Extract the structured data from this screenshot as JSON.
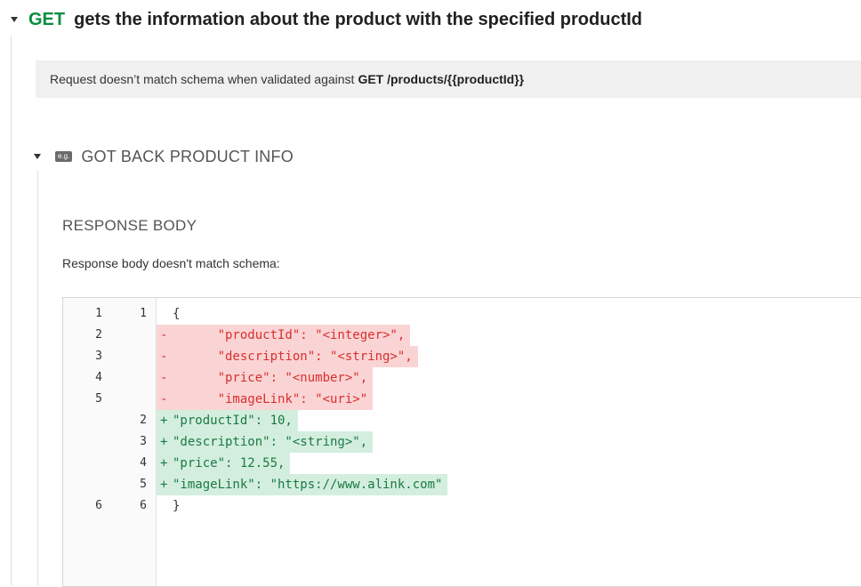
{
  "request": {
    "method": "GET",
    "title": "gets the information about the product with the specified productId",
    "validation_message": "Request doesn’t match schema when validated against",
    "validation_endpoint": "GET /products/{{productId}}"
  },
  "example": {
    "badge": "e.g.",
    "name": "GOT BACK PRODUCT INFO",
    "response_body_heading": "RESPONSE BODY",
    "response_body_message": "Response body doesn't match schema:"
  },
  "diff": [
    {
      "old": "1",
      "new": "1",
      "type": "context",
      "sign": " ",
      "text": "{"
    },
    {
      "old": "2",
      "new": "",
      "type": "removed",
      "sign": "-",
      "text": "      \"productId\": \"<integer>\","
    },
    {
      "old": "3",
      "new": "",
      "type": "removed",
      "sign": "-",
      "text": "      \"description\": \"<string>\","
    },
    {
      "old": "4",
      "new": "",
      "type": "removed",
      "sign": "-",
      "text": "      \"price\": \"<number>\","
    },
    {
      "old": "5",
      "new": "",
      "type": "removed",
      "sign": "-",
      "text": "      \"imageLink\": \"<uri>\""
    },
    {
      "old": "",
      "new": "2",
      "type": "added",
      "sign": "+",
      "text": "\"productId\": 10,"
    },
    {
      "old": "",
      "new": "3",
      "type": "added",
      "sign": "+",
      "text": "\"description\": \"<string>\","
    },
    {
      "old": "",
      "new": "4",
      "type": "added",
      "sign": "+",
      "text": "\"price\": 12.55,"
    },
    {
      "old": "",
      "new": "5",
      "type": "added",
      "sign": "+",
      "text": "\"imageLink\": \"https://www.alink.com\""
    },
    {
      "old": "6",
      "new": "6",
      "type": "context",
      "sign": " ",
      "text": "}"
    }
  ]
}
